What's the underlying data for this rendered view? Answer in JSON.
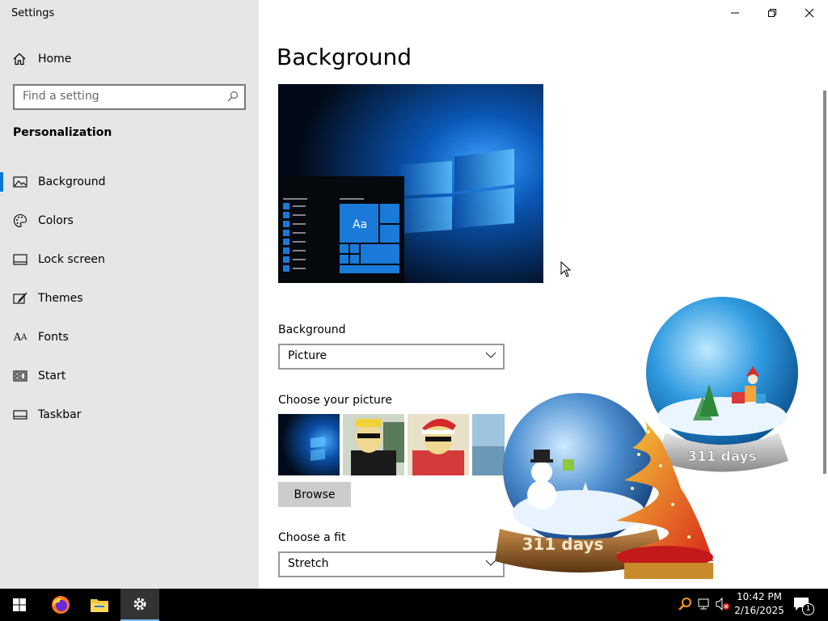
{
  "window": {
    "title": "Settings"
  },
  "sidebar": {
    "home_label": "Home",
    "search_placeholder": "Find a setting",
    "section_title": "Personalization",
    "items": [
      {
        "label": "Background",
        "icon": "picture-icon",
        "active": true
      },
      {
        "label": "Colors",
        "icon": "palette-icon"
      },
      {
        "label": "Lock screen",
        "icon": "lock-screen-icon"
      },
      {
        "label": "Themes",
        "icon": "themes-icon"
      },
      {
        "label": "Fonts",
        "icon": "fonts-icon"
      },
      {
        "label": "Start",
        "icon": "start-icon"
      },
      {
        "label": "Taskbar",
        "icon": "taskbar-icon"
      }
    ]
  },
  "main": {
    "title": "Background",
    "preview_sample_text": "Aa",
    "background_label": "Background",
    "background_value": "Picture",
    "choose_picture_label": "Choose your picture",
    "browse_label": "Browse",
    "fit_label": "Choose a fit",
    "fit_value": "Stretch"
  },
  "gadget": {
    "front_globe_text": "311 days",
    "back_globe_text": "311 days"
  },
  "taskbar": {
    "time": "10:42 PM",
    "date": "2/16/2025",
    "notification_count": "1",
    "apps": [
      "start-icon",
      "firefox-icon",
      "file-explorer-icon",
      "settings-icon"
    ]
  },
  "colors": {
    "accent": "#0078d7",
    "sidebar_bg": "#e6e6e6",
    "taskbar_bg": "#000000"
  }
}
